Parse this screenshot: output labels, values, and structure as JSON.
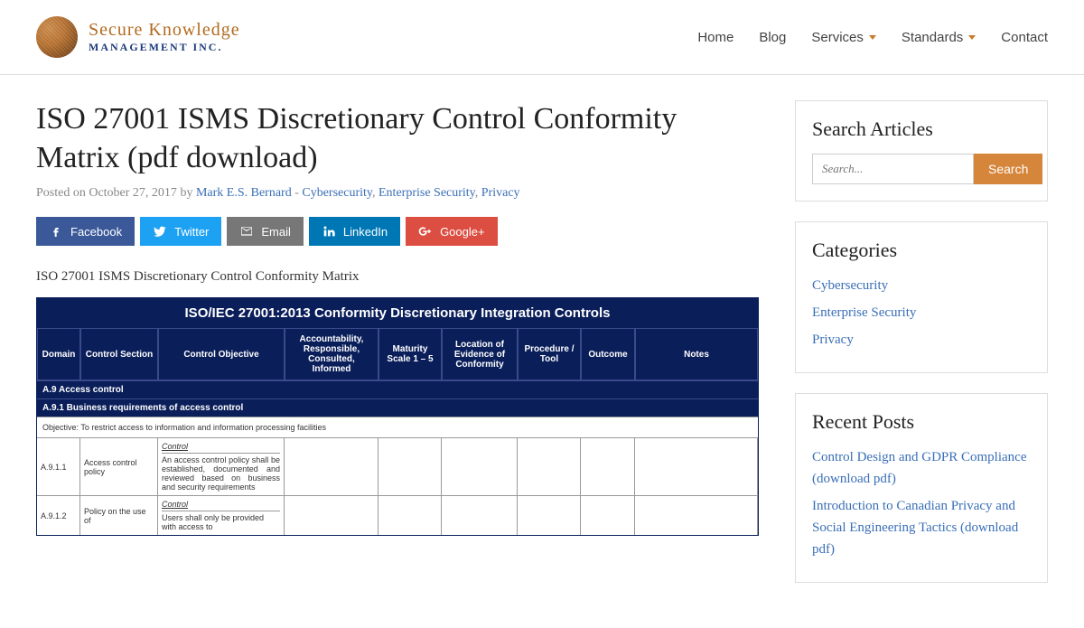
{
  "logo": {
    "line1": "Secure Knowledge",
    "line2": "MANAGEMENT INC."
  },
  "nav": [
    {
      "label": "Home",
      "dd": false
    },
    {
      "label": "Blog",
      "dd": false
    },
    {
      "label": "Services",
      "dd": true
    },
    {
      "label": "Standards",
      "dd": true
    },
    {
      "label": "Contact",
      "dd": false
    }
  ],
  "post": {
    "title": "ISO 27001 ISMS Discretionary Control Conformity Matrix (pdf download)",
    "posted_prefix": "Posted on ",
    "date": "October 27, 2017",
    "by": " by ",
    "author": "Mark E.S. Bernard",
    "sep": " - ",
    "tags": [
      "Cybersecurity",
      "Enterprise Security",
      "Privacy"
    ],
    "lead": "ISO 27001 ISMS Discretionary Control Conformity Matrix"
  },
  "share": {
    "fb": "Facebook",
    "tw": "Twitter",
    "em": "Email",
    "li": "LinkedIn",
    "gp": "Google+"
  },
  "matrix": {
    "title": "ISO/IEC 27001:2013 Conformity Discretionary Integration Controls",
    "headers": {
      "domain": "Domain",
      "section": "Control Section",
      "objective": "Control Objective",
      "acc": "Accountability, Responsible, Consulted, Informed",
      "maturity": "Maturity Scale 1 – 5",
      "location": "Location of Evidence of Conformity",
      "procedure": "Procedure / Tool",
      "outcome": "Outcome",
      "notes": "Notes"
    },
    "sec1": "A.9 Access control",
    "sec2": "A.9.1 Business requirements of access control",
    "objective_text": "Objective: To restrict access to information and information processing facilities",
    "rows": [
      {
        "id": "A.9.1.1",
        "section": "Access control policy",
        "control": "Control",
        "desc": "An access control policy shall be established, documented and reviewed based on business and security requirements"
      },
      {
        "id": "A.9.1.2",
        "section": "Policy on the use of",
        "control": "Control",
        "desc": "Users shall only be provided with access to"
      }
    ]
  },
  "sidebar": {
    "search": {
      "title": "Search Articles",
      "placeholder": "Search...",
      "button": "Search"
    },
    "categories": {
      "title": "Categories",
      "items": [
        "Cybersecurity",
        "Enterprise Security",
        "Privacy"
      ]
    },
    "recent": {
      "title": "Recent Posts",
      "items": [
        "Control Design and GDPR Compliance (download pdf)",
        "Introduction to Canadian Privacy and Social Engineering Tactics (download pdf)"
      ]
    }
  }
}
